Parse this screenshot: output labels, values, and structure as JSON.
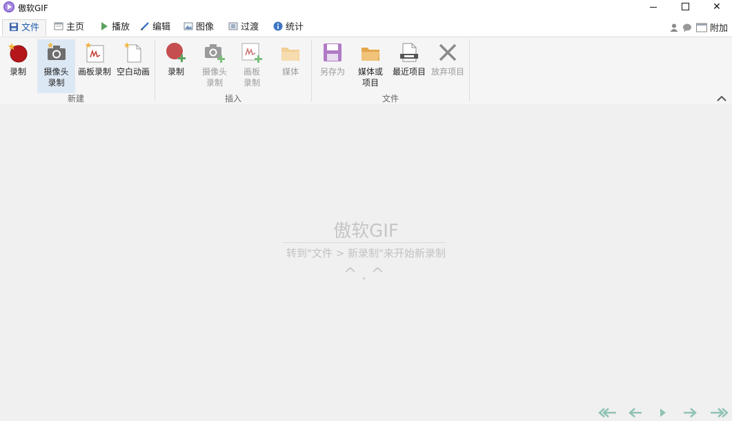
{
  "window": {
    "title": "傲软GIF"
  },
  "tabs": [
    {
      "label": "文件",
      "icon": "save-icon",
      "active": true
    },
    {
      "label": "主页",
      "icon": "home-icon"
    },
    {
      "label": "播放",
      "icon": "play-icon"
    },
    {
      "label": "编辑",
      "icon": "pencil-icon"
    },
    {
      "label": "图像",
      "icon": "image-icon"
    },
    {
      "label": "过渡",
      "icon": "transition-icon"
    },
    {
      "label": "统计",
      "icon": "info-icon"
    }
  ],
  "extras": {
    "label": "附加"
  },
  "ribbon": {
    "new_group": {
      "label": "新建",
      "record": "录制",
      "webcam_line1": "摄像头",
      "webcam_line2": "录制",
      "board": "画板录制",
      "blank": "空白动画"
    },
    "insert_group": {
      "label": "插入",
      "record": "录制",
      "webcam_line1": "摄像头",
      "webcam_line2": "录制",
      "board_line1": "画板",
      "board_line2": "录制",
      "media": "媒体"
    },
    "file_group": {
      "label": "文件",
      "save_as": "另存为",
      "media_project_line1": "媒体或",
      "media_project_line2": "项目",
      "recent": "最近项目",
      "discard": "放弃项目"
    }
  },
  "welcome": {
    "title": "傲软GIF",
    "hint": "转到\"文件 > 新录制\"来开始新录制",
    "face": "^.^"
  },
  "colors": {
    "accent": "#1f5eb0",
    "record_red": "#c0181b",
    "folder": "#e8b25c",
    "save_purple": "#9b5bb5"
  }
}
